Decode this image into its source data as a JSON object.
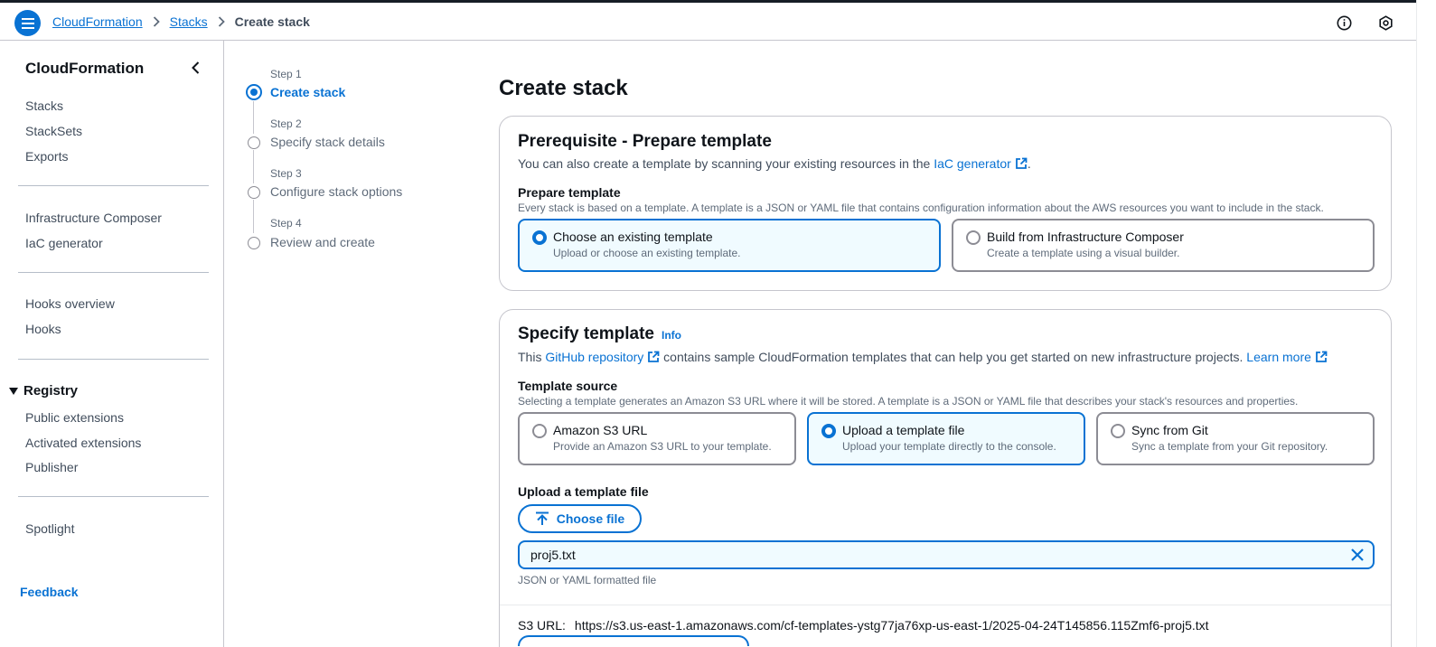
{
  "breadcrumb": {
    "items": [
      "CloudFormation",
      "Stacks"
    ],
    "current": "Create stack"
  },
  "topbar": {
    "icons": [
      "info-icon",
      "settings-hex-icon"
    ]
  },
  "sidebar": {
    "title": "CloudFormation",
    "group1": [
      "Stacks",
      "StackSets",
      "Exports"
    ],
    "group2": [
      "Infrastructure Composer",
      "IaC generator"
    ],
    "group3": [
      "Hooks overview",
      "Hooks"
    ],
    "registry": {
      "label": "Registry",
      "items": [
        "Public extensions",
        "Activated extensions",
        "Publisher"
      ]
    },
    "group5": [
      "Spotlight"
    ],
    "feedback": "Feedback"
  },
  "wizard": {
    "steps": [
      {
        "num": "Step 1",
        "label": "Create stack"
      },
      {
        "num": "Step 2",
        "label": "Specify stack details"
      },
      {
        "num": "Step 3",
        "label": "Configure stack options"
      },
      {
        "num": "Step 4",
        "label": "Review and create"
      }
    ]
  },
  "main": {
    "title": "Create stack",
    "prereq": {
      "heading": "Prerequisite - Prepare template",
      "desc_before": "You can also create a template by scanning your existing resources in the ",
      "desc_link": "IaC generator",
      "desc_after": ".",
      "field_label": "Prepare template",
      "field_desc": "Every stack is based on a template. A template is a JSON or YAML file that contains configuration information about the AWS resources you want to include in the stack.",
      "options": [
        {
          "title": "Choose an existing template",
          "desc": "Upload or choose an existing template."
        },
        {
          "title": "Build from Infrastructure Composer",
          "desc": "Create a template using a visual builder."
        }
      ]
    },
    "specify": {
      "heading": "Specify template",
      "info": "Info",
      "desc_before": "This ",
      "desc_link": "GitHub repository",
      "desc_middle": " contains sample CloudFormation templates that can help you get started on new infrastructure projects. ",
      "desc_link2": "Learn more",
      "field_label": "Template source",
      "field_desc": "Selecting a template generates an Amazon S3 URL where it will be stored. A template is a JSON or YAML file that describes your stack's resources and properties.",
      "options": [
        {
          "title": "Amazon S3 URL",
          "desc": "Provide an Amazon S3 URL to your template."
        },
        {
          "title": "Upload a template file",
          "desc": "Upload your template directly to the console."
        },
        {
          "title": "Sync from Git",
          "desc": "Sync a template from your Git repository."
        }
      ],
      "upload_label": "Upload a template file",
      "choose_file": "Choose file",
      "file_name": "proj5.txt",
      "file_hint": "JSON or YAML formatted file",
      "s3_label": "S3 URL:",
      "s3_value": "https://s3.us-east-1.amazonaws.com/cf-templates-ystg77ja76xp-us-east-1/2025-04-24T145856.115Zmf6-proj5.txt"
    }
  },
  "colors": {
    "accent": "#0972d3",
    "selected_bg": "#f0fbff",
    "border": "#c6c6cd",
    "text": "#0f141a",
    "muted": "#5f6b7a"
  }
}
